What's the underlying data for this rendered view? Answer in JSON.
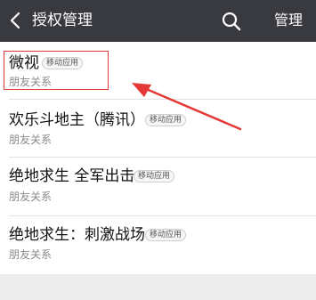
{
  "header": {
    "title": "授权管理",
    "manage_label": "管理",
    "icons": {
      "back": "chevron-left-icon",
      "search": "search-icon"
    }
  },
  "apps": [
    {
      "name": "微视",
      "tag": "移动应用",
      "relation": "朋友关系"
    },
    {
      "name": "欢乐斗地主（腾讯）",
      "tag": "移动应用",
      "relation": "朋友关系"
    },
    {
      "name": "绝地求生 全军出击",
      "tag": "移动应用",
      "relation": "朋友关系"
    },
    {
      "name": "绝地求生：刺激战场",
      "tag": "移动应用",
      "relation": "朋友关系"
    }
  ],
  "annotation": {
    "color": "#e53935"
  },
  "colors": {
    "topbar": "#393a3f",
    "background": "#ececec"
  }
}
